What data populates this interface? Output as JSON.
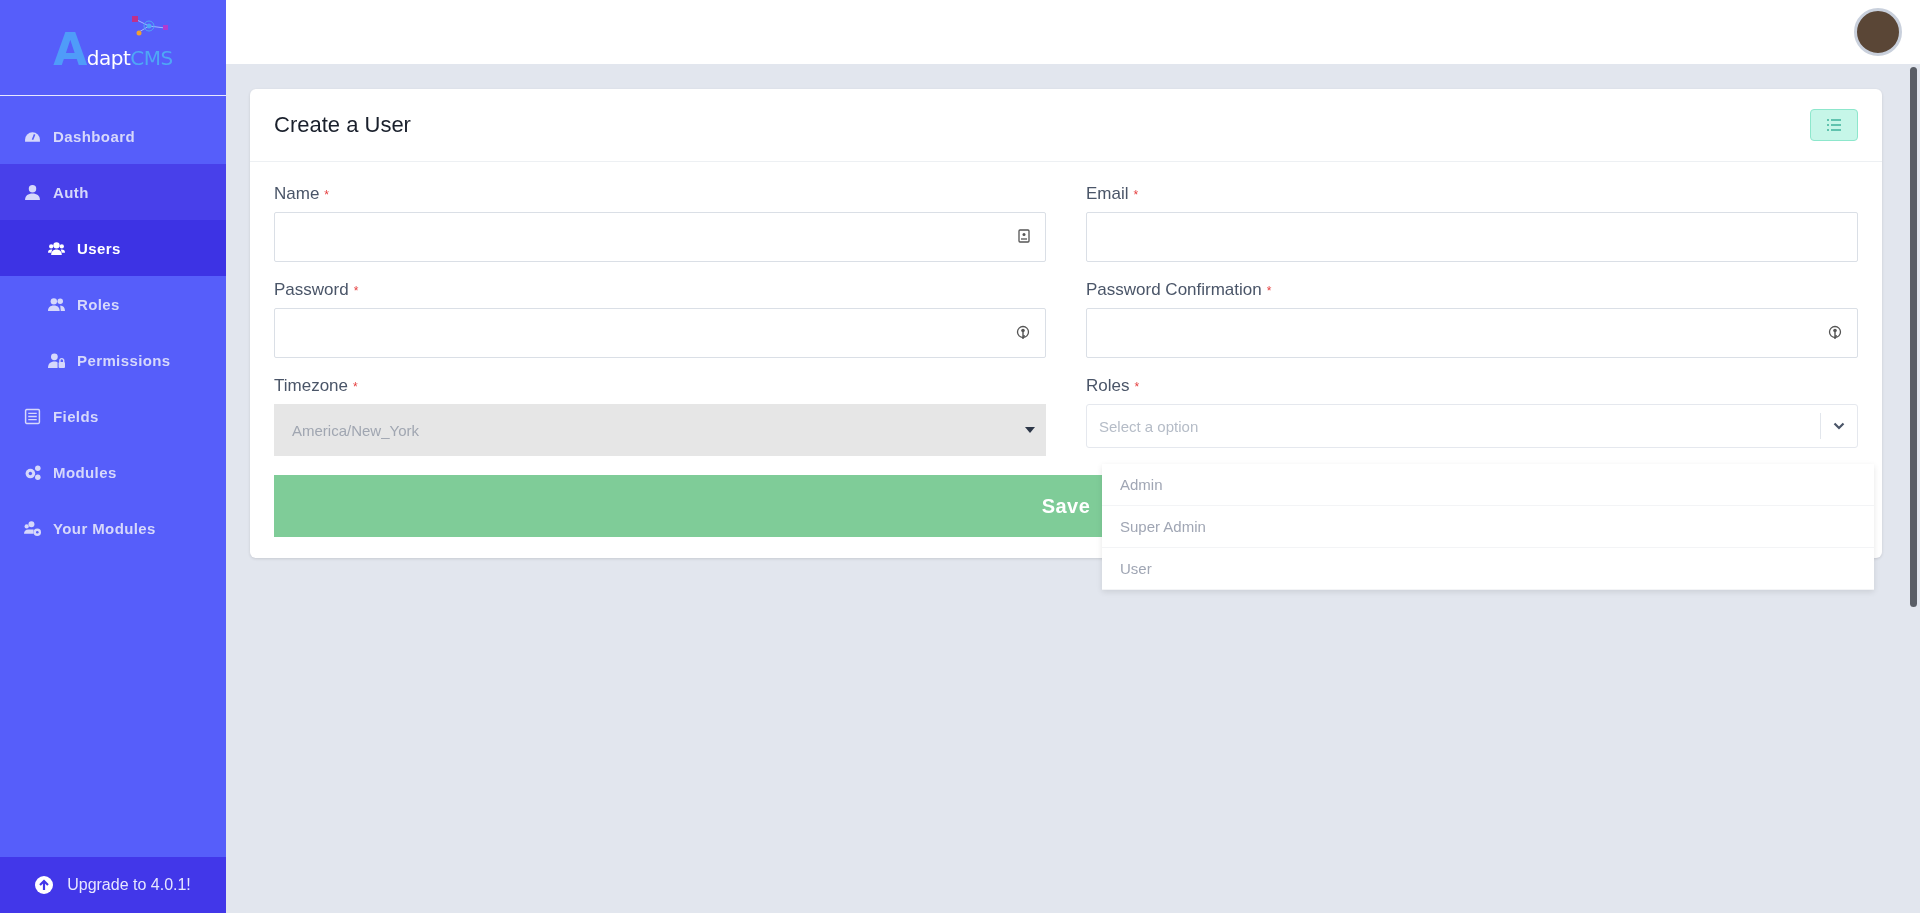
{
  "sidebar": {
    "logo": [
      "A",
      "dapt",
      "CMS"
    ],
    "items": [
      {
        "label": "Dashboard",
        "selected": false,
        "expanded": false
      },
      {
        "label": "Auth",
        "selected": false,
        "expanded": true,
        "children": [
          {
            "label": "Users",
            "selected": true
          },
          {
            "label": "Roles",
            "selected": false
          },
          {
            "label": "Permissions",
            "selected": false
          }
        ]
      },
      {
        "label": "Fields",
        "selected": false,
        "expanded": false
      },
      {
        "label": "Modules",
        "selected": false,
        "expanded": false
      },
      {
        "label": "Your Modules",
        "selected": false,
        "expanded": false
      }
    ],
    "upgrade": {
      "label": "Upgrade to 4.0.1!"
    }
  },
  "form": {
    "title": "Create a User",
    "fields": [
      {
        "kind": "text",
        "label": "Name",
        "required_mark": "*"
      },
      {
        "kind": "text",
        "label": "Email",
        "required_mark": "*"
      },
      {
        "kind": "password",
        "label": "Password",
        "required_mark": "*"
      },
      {
        "kind": "password",
        "label": "Password Confirmation",
        "required_mark": "*"
      },
      {
        "kind": "select",
        "label": "Timezone",
        "required_mark": "*",
        "value": "America/New_York",
        "disabled": true
      },
      {
        "kind": "multiselect",
        "label": "Roles",
        "required_mark": "*",
        "placeholder": "Select a option",
        "expanded": true,
        "options": [
          {
            "label": "Admin",
            "selected": false
          },
          {
            "label": "Super Admin",
            "selected": false
          },
          {
            "label": "User",
            "selected": false
          }
        ]
      }
    ],
    "save_button": "Save"
  }
}
